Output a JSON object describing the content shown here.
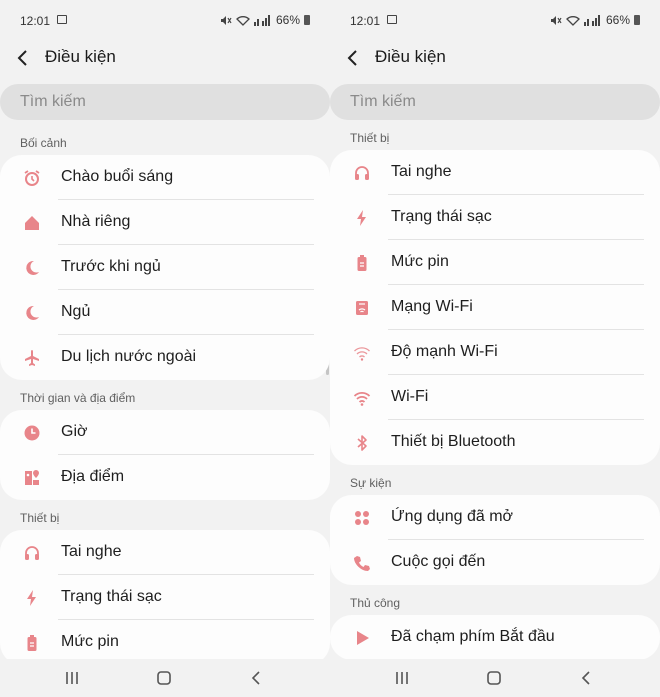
{
  "status": {
    "time": "12:01",
    "battery": "66%"
  },
  "header": {
    "title": "Điều kiện"
  },
  "search": {
    "placeholder": "Tìm kiếm"
  },
  "colors": {
    "accent_icon": "#e8858a",
    "background": "#f2f2f2",
    "card": "#fdfdfd"
  },
  "left": {
    "sections": [
      {
        "label": "Bối cảnh",
        "items": [
          {
            "label": "Chào buổi sáng",
            "icon": "alarm-icon"
          },
          {
            "label": "Nhà riêng",
            "icon": "home-icon"
          },
          {
            "label": "Trước khi ngủ",
            "icon": "moon-icon"
          },
          {
            "label": "Ngủ",
            "icon": "moon-icon"
          },
          {
            "label": "Du lịch nước ngoài",
            "icon": "airplane-icon"
          }
        ]
      },
      {
        "label": "Thời gian và địa điểm",
        "items": [
          {
            "label": "Giờ",
            "icon": "clock-icon"
          },
          {
            "label": "Địa điểm",
            "icon": "map-pin-icon"
          }
        ]
      },
      {
        "label": "Thiết bị",
        "items": [
          {
            "label": "Tai nghe",
            "icon": "headphones-icon"
          },
          {
            "label": "Trạng thái sạc",
            "icon": "charging-bolt-icon"
          },
          {
            "label": "Mức pin",
            "icon": "battery-icon"
          }
        ]
      }
    ]
  },
  "right": {
    "sections": [
      {
        "label": "Thiết bị",
        "items": [
          {
            "label": "Tai nghe",
            "icon": "headphones-icon"
          },
          {
            "label": "Trạng thái sạc",
            "icon": "charging-bolt-icon"
          },
          {
            "label": "Mức pin",
            "icon": "battery-icon"
          },
          {
            "label": "Mạng Wi-Fi",
            "icon": "wifi-network-icon"
          },
          {
            "label": "Độ mạnh Wi-Fi",
            "icon": "wifi-strength-icon"
          },
          {
            "label": "Wi-Fi",
            "icon": "wifi-icon"
          },
          {
            "label": "Thiết bị Bluetooth",
            "icon": "bluetooth-icon"
          }
        ]
      },
      {
        "label": "Sự kiện",
        "items": [
          {
            "label": "Ứng dụng đã mở",
            "icon": "apps-icon"
          },
          {
            "label": "Cuộc gọi đến",
            "icon": "phone-icon"
          }
        ]
      },
      {
        "label": "Thủ công",
        "items": [
          {
            "label": "Đã chạm phím Bắt đầu",
            "icon": "play-icon"
          }
        ]
      }
    ]
  }
}
